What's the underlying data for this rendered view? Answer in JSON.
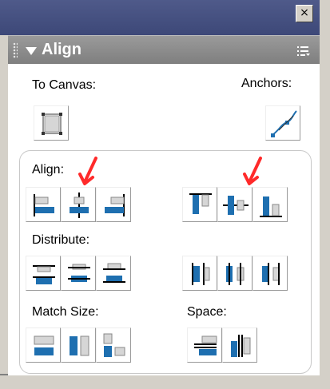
{
  "window": {
    "close_glyph": "×"
  },
  "panel": {
    "title": "Align",
    "options_icon": "panel-menu-icon"
  },
  "labels": {
    "to_canvas": "To Canvas:",
    "anchors": "Anchors:",
    "align": "Align:",
    "distribute": "Distribute:",
    "match_size": "Match Size:",
    "space": "Space:"
  },
  "colors": {
    "accent": "#1e6fb0",
    "annotation": "#ff2a2a"
  },
  "annotations": {
    "count": 2
  }
}
